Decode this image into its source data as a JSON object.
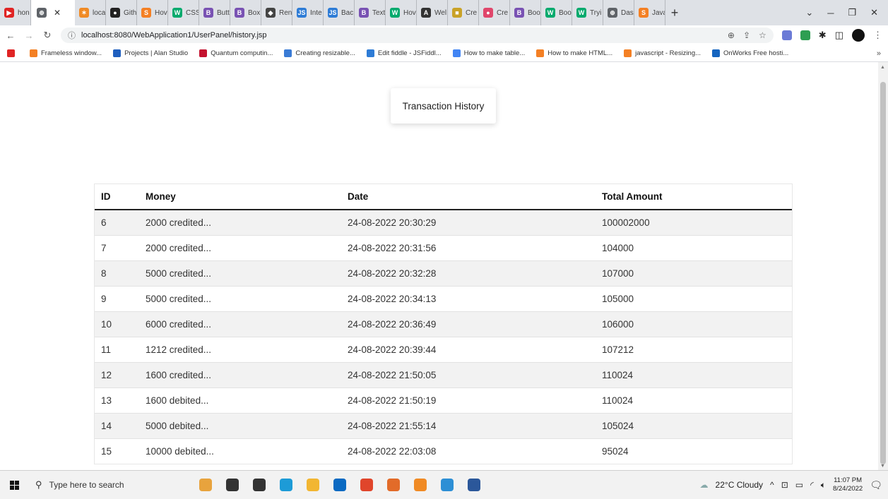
{
  "browser": {
    "tabs": [
      {
        "label": "hon",
        "icon": "youtube-icon",
        "color": "#e02424",
        "glyph": "▶"
      },
      {
        "label": "",
        "icon": "globe-icon",
        "color": "#5f6368",
        "glyph": "⊕",
        "active": true
      },
      {
        "label": "loca",
        "icon": "xampp-icon",
        "color": "#f08a24",
        "glyph": "✶"
      },
      {
        "label": "Gith",
        "icon": "github-icon",
        "color": "#222222",
        "glyph": "●"
      },
      {
        "label": "Hov",
        "icon": "stackoverflow-icon",
        "color": "#f48024",
        "glyph": "S"
      },
      {
        "label": "CSS",
        "icon": "w3schools-icon",
        "color": "#04aa6d",
        "glyph": "W"
      },
      {
        "label": "Butt",
        "icon": "bootstrap-icon",
        "color": "#7952b3",
        "glyph": "B"
      },
      {
        "label": "Box",
        "icon": "bootstrap-icon",
        "color": "#7952b3",
        "glyph": "B"
      },
      {
        "label": "Ren",
        "icon": "render-icon",
        "color": "#444444",
        "glyph": "◆"
      },
      {
        "label": "Inte",
        "icon": "jsfiddle-icon",
        "color": "#2e7cd6",
        "glyph": "JS"
      },
      {
        "label": "Bac",
        "icon": "jsfiddle-icon",
        "color": "#2e7cd6",
        "glyph": "JS"
      },
      {
        "label": "Text",
        "icon": "bootstrap-icon",
        "color": "#7952b3",
        "glyph": "B"
      },
      {
        "label": "Hov",
        "icon": "w3schools-icon",
        "color": "#04aa6d",
        "glyph": "W"
      },
      {
        "label": "Wel",
        "icon": "wel-icon",
        "color": "#333333",
        "glyph": "A"
      },
      {
        "label": "Cre",
        "icon": "create-icon",
        "color": "#c9a227",
        "glyph": "■"
      },
      {
        "label": "Cre",
        "icon": "create-round-icon",
        "color": "#e0466b",
        "glyph": "●"
      },
      {
        "label": "Boo",
        "icon": "bootstrap-icon",
        "color": "#7952b3",
        "glyph": "B"
      },
      {
        "label": "Boo",
        "icon": "w3schools-icon",
        "color": "#04aa6d",
        "glyph": "W"
      },
      {
        "label": "Tryi",
        "icon": "w3schools-icon",
        "color": "#04aa6d",
        "glyph": "W"
      },
      {
        "label": "Das",
        "icon": "globe-icon",
        "color": "#5f6368",
        "glyph": "⊕"
      },
      {
        "label": "Java",
        "icon": "stackoverflow-icon",
        "color": "#f48024",
        "glyph": "S"
      }
    ],
    "url": "localhost:8080/WebApplication1/UserPanel/history.jsp",
    "bookmarks": [
      {
        "label": "",
        "color": "#e02424"
      },
      {
        "label": "Frameless window...",
        "color": "#f48024"
      },
      {
        "label": "Projects | Alan Studio",
        "color": "#1f5fbf"
      },
      {
        "label": "Quantum computin...",
        "color": "#c4122f"
      },
      {
        "label": "Creating resizable...",
        "color": "#3a7bd5"
      },
      {
        "label": "Edit fiddle - JSFiddl...",
        "color": "#2e7cd6"
      },
      {
        "label": "How to make table...",
        "color": "#4285f4"
      },
      {
        "label": "How to make HTML...",
        "color": "#f48024"
      },
      {
        "label": "javascript - Resizing...",
        "color": "#f48024"
      },
      {
        "label": "OnWorks Free hosti...",
        "color": "#1565c0"
      }
    ]
  },
  "page": {
    "title": "Transaction History",
    "table": {
      "headers": [
        "ID",
        "Money",
        "Date",
        "Total Amount"
      ],
      "rows": [
        [
          "6",
          "2000 credited...",
          "24-08-2022 20:30:29",
          "100002000"
        ],
        [
          "7",
          "2000 credited...",
          "24-08-2022 20:31:56",
          "104000"
        ],
        [
          "8",
          "5000 credited...",
          "24-08-2022 20:32:28",
          "107000"
        ],
        [
          "9",
          "5000 credited...",
          "24-08-2022 20:34:13",
          "105000"
        ],
        [
          "10",
          "6000 credited...",
          "24-08-2022 20:36:49",
          "106000"
        ],
        [
          "11",
          "1212 credited...",
          "24-08-2022 20:39:44",
          "107212"
        ],
        [
          "12",
          "1600 credited...",
          "24-08-2022 21:50:05",
          "110024"
        ],
        [
          "13",
          "1600 debited...",
          "24-08-2022 21:50:19",
          "110024"
        ],
        [
          "14",
          "5000 debited...",
          "24-08-2022 21:55:14",
          "105024"
        ],
        [
          "15",
          "10000 debited...",
          "24-08-2022 22:03:08",
          "95024"
        ]
      ]
    }
  },
  "taskbar": {
    "search_placeholder": "Type here to search",
    "weather": "22°C  Cloudy",
    "time": "11:07 PM",
    "date": "8/24/2022",
    "apps": [
      {
        "name": "widget-icon",
        "color": "#e8a33d"
      },
      {
        "name": "cortana-icon",
        "color": "#333333"
      },
      {
        "name": "task-view-icon",
        "color": "#333333"
      },
      {
        "name": "edge-icon",
        "color": "#1d9bd7"
      },
      {
        "name": "file-explorer-icon",
        "color": "#f2b632"
      },
      {
        "name": "mail-icon",
        "color": "#0b6ac2"
      },
      {
        "name": "chrome-icon",
        "color": "#e0452b"
      },
      {
        "name": "office-icon",
        "color": "#e26b29"
      },
      {
        "name": "xampp-icon",
        "color": "#f08a24"
      },
      {
        "name": "sourcetree-icon",
        "color": "#2d8fd5"
      },
      {
        "name": "word-icon",
        "color": "#2b579a"
      }
    ]
  }
}
